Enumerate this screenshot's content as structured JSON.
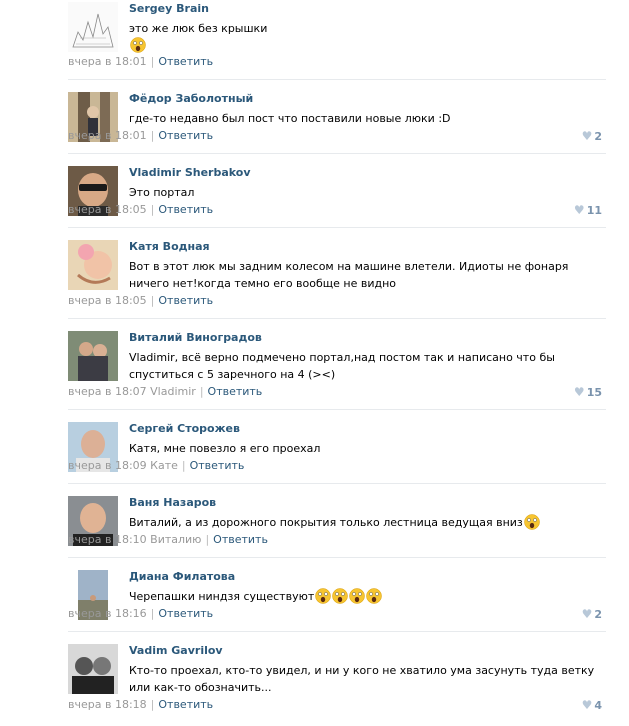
{
  "meta_labels": {
    "reply": "Ответить",
    "separator": "|"
  },
  "comments": [
    {
      "author": "Sergey Brain",
      "text": "это же люк без крышки",
      "emojis_after_text": [],
      "emoji_line": [
        "scared-face"
      ],
      "time": "вчера в 18:01",
      "reply_to": "",
      "likes": ""
    },
    {
      "author": "Фёдор Заболотный",
      "text": "где-то недавно был пост что поставили новые люки :D",
      "emojis_after_text": [],
      "emoji_line": [],
      "time": "вчера в 18:01",
      "reply_to": "",
      "likes": "2"
    },
    {
      "author": "Vladimir Sherbakov",
      "text": "Это портал",
      "emojis_after_text": [],
      "emoji_line": [],
      "time": "вчера в 18:05",
      "reply_to": "",
      "likes": "11"
    },
    {
      "author": "Катя Водная",
      "text": "Вот в этот люк мы задним колесом на машине влетели. Идиоты не фонаря ничего нет!когда темно его вообще не видно",
      "emojis_after_text": [],
      "emoji_line": [],
      "time": "вчера в 18:05",
      "reply_to": "",
      "likes": ""
    },
    {
      "author": "Виталий Виноградов",
      "text": "Vladimir, всё верно подмечено портал,над постом так и написано что бы спуститься с 5 заречного на 4 (><)",
      "emojis_after_text": [],
      "emoji_line": [],
      "time": "вчера в 18:07",
      "reply_to": "Vladimir",
      "likes": "15"
    },
    {
      "author": "Сергей Сторожев",
      "text": "Катя, мне повезло я его проехал",
      "emojis_after_text": [],
      "emoji_line": [],
      "time": "вчера в 18:09",
      "reply_to": "Кате",
      "likes": ""
    },
    {
      "author": "Ваня Назаров",
      "text": "Виталий, а из дорожного покрытия только лестница ведущая вниз",
      "emojis_after_text": [
        "scared-face"
      ],
      "emoji_line": [],
      "time": "вчера в 18:10",
      "reply_to": "Виталию",
      "likes": ""
    },
    {
      "author": "Диана Филатова",
      "text": "Черепашки ниндзя существуют",
      "emojis_after_text": [
        "scared-face",
        "scared-face",
        "scared-face",
        "scared-face"
      ],
      "emoji_line": [],
      "time": "вчера в 18:16",
      "reply_to": "",
      "likes": "2"
    },
    {
      "author": "Vadim Gavrilov",
      "text": "Кто-то проехал, кто-то увидел, и ни у кого не хватило ума засунуть туда ветку или как-то обозначить...",
      "emojis_after_text": [],
      "emoji_line": [],
      "time": "вчера в 18:18",
      "reply_to": "",
      "likes": "4"
    }
  ],
  "colors": {
    "link": "#2b587a",
    "meta": "#999999",
    "likes": "#7a93ad",
    "divider": "#e7eaed"
  }
}
